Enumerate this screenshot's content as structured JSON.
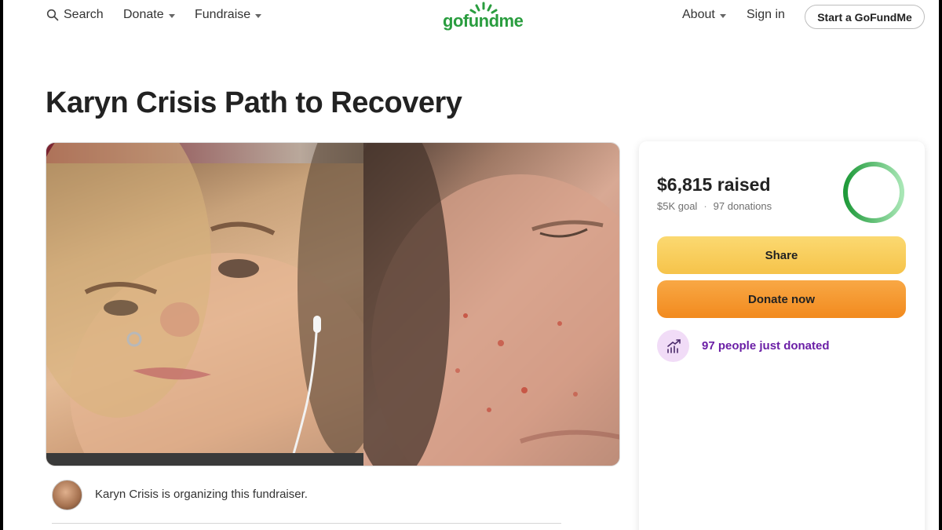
{
  "header": {
    "search_label": "Search",
    "donate_label": "Donate",
    "fundraise_label": "Fundraise",
    "logo_text": "gofundme",
    "about_label": "About",
    "signin_label": "Sign in",
    "start_label": "Start a GoFundMe"
  },
  "campaign": {
    "title": "Karyn Crisis Path to Recovery",
    "organizer_text": "Karyn Crisis is organizing this fundraiser."
  },
  "donation": {
    "raised": "$6,815 raised",
    "goal": "$5K goal",
    "separator": "·",
    "donations": "97 donations",
    "progress_fraction": 1.0,
    "share_label": "Share",
    "donate_label": "Donate now",
    "activity_text": "97 people just donated"
  },
  "icons": [
    "search-icon",
    "chevron-down-icon",
    "trending-up-icon"
  ],
  "colors": {
    "brand_green": "#2a9d3f",
    "share_yellow": "#f6c34a",
    "donate_orange": "#f28a1e",
    "activity_purple": "#6b1fa6"
  }
}
